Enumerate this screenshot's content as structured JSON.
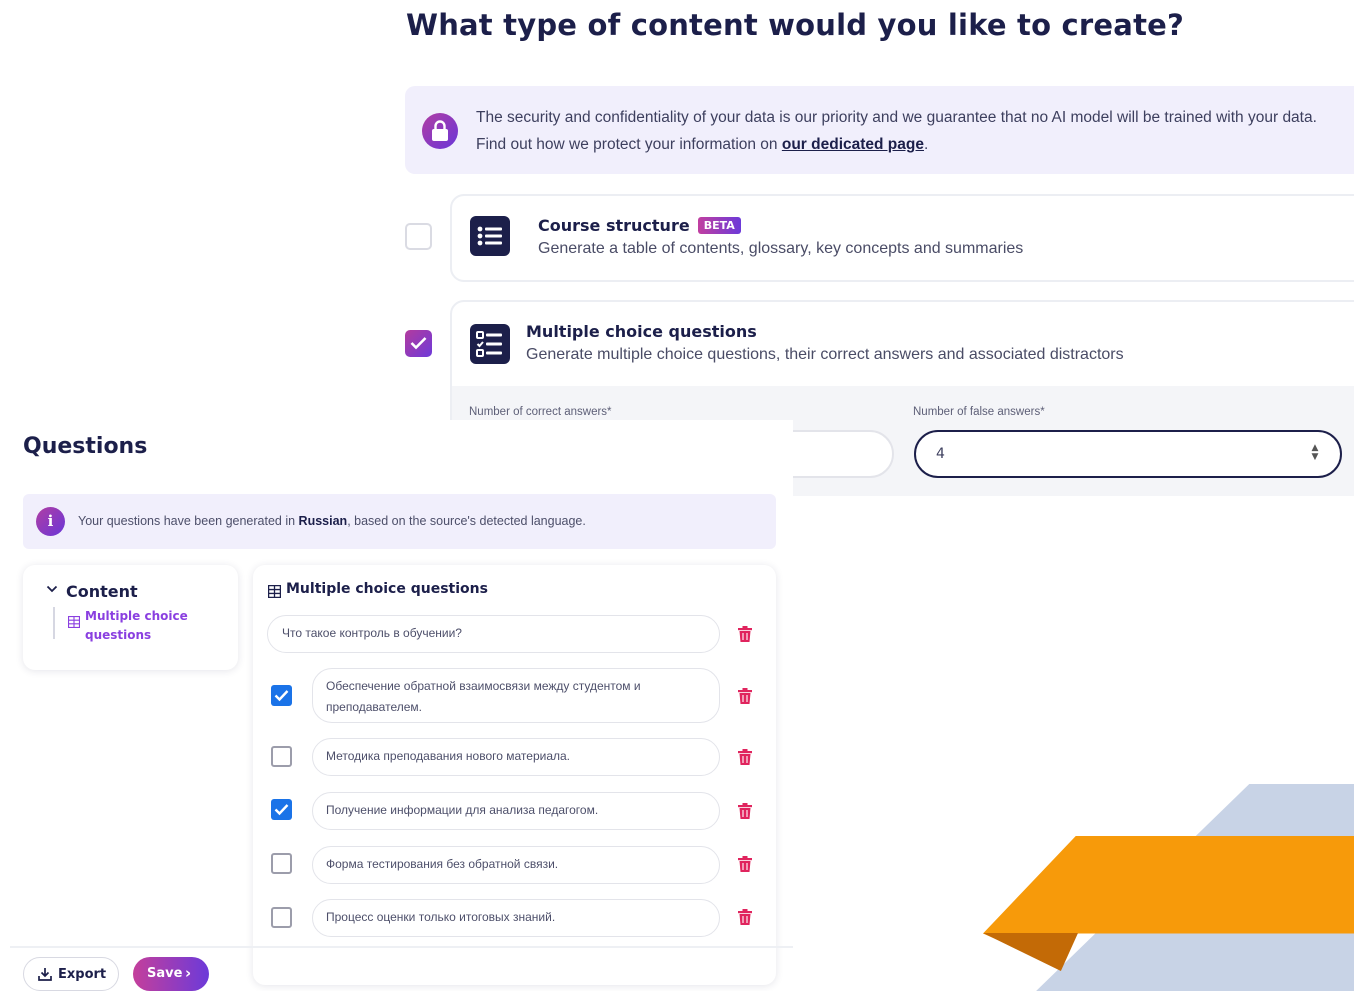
{
  "wizard": {
    "title": "What type of content would you like to create?",
    "security": {
      "text_before": "The security and confidentiality of your data is our priority and we guarantee that no AI model will be trained with your data. Find out how we protect your information on ",
      "link_label": "our dedicated page",
      "text_after": "."
    },
    "options": [
      {
        "title": "Course structure",
        "badge": "BETA",
        "description": "Generate a table of contents, glossary, key concepts and summaries",
        "checked": false,
        "icon": "list-icon"
      },
      {
        "title": "Multiple choice questions",
        "description": "Generate multiple choice questions, their correct answers and associated distractors",
        "checked": true,
        "icon": "checklist-icon"
      }
    ],
    "settings": {
      "correct_label": "Number of correct answers*",
      "false_label": "Number of false answers*",
      "false_value": "4"
    }
  },
  "questions_panel": {
    "title": "Questions",
    "info": {
      "before": "Your questions have been generated in ",
      "language": "Russian",
      "after": ", based on the source's detected language."
    },
    "toc": {
      "heading": "Content",
      "item": "Multiple choice questions"
    },
    "mcq": {
      "heading": "Multiple choice questions",
      "question": "Что такое контроль в обучении?",
      "answers": [
        {
          "text": "Обеспечение обратной взаимосвязи между студентом и преподавателем.",
          "correct": true
        },
        {
          "text": "Методика преподавания нового материала.",
          "correct": false
        },
        {
          "text": "Получение информации для анализа педагогом.",
          "correct": true
        },
        {
          "text": "Форма тестирования без обратной связи.",
          "correct": false
        },
        {
          "text": "Процесс оценки только итоговых знаний.",
          "correct": false
        }
      ]
    },
    "footer": {
      "export_label": "Export",
      "save_label": "Save"
    }
  },
  "colors": {
    "navy": "#1c1f4a",
    "accent_purple": "#8a3fe0",
    "checkbox_blue": "#1a73e8",
    "trash_red": "#e0245e",
    "info_bg": "#f1effc"
  }
}
